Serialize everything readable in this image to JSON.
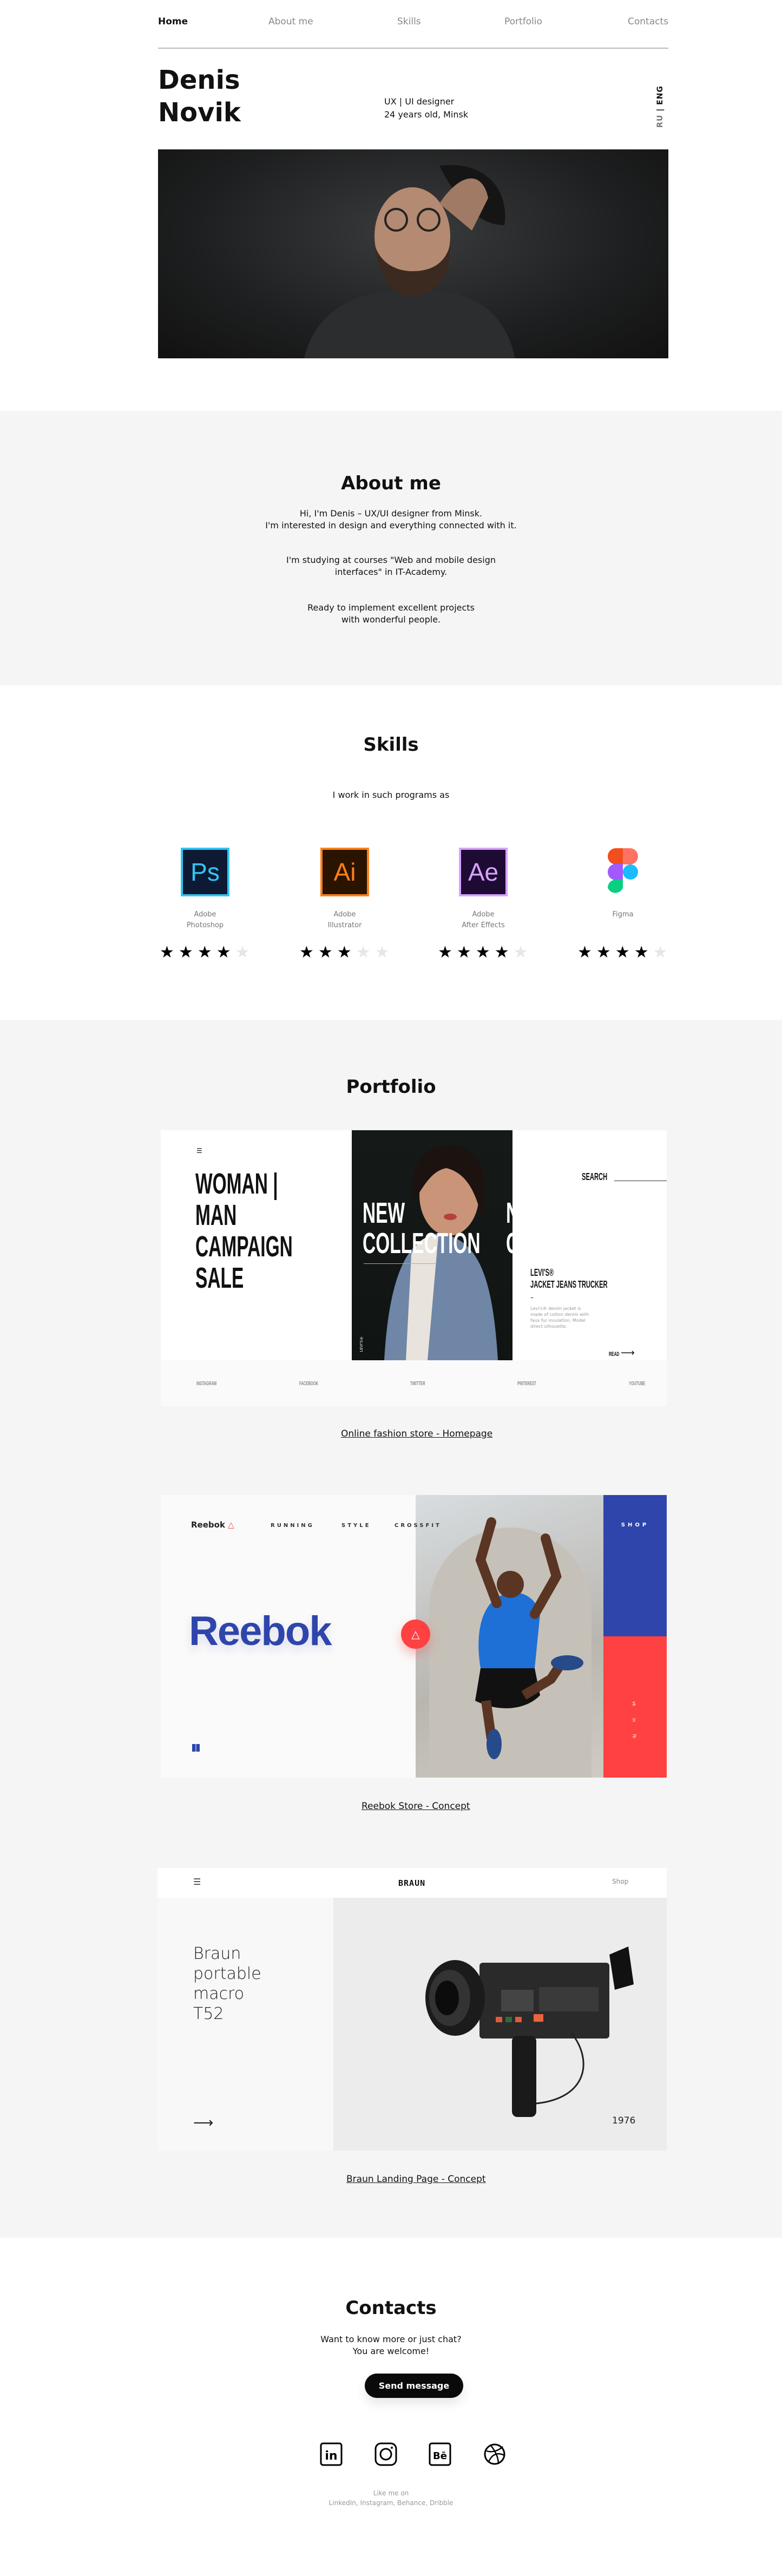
{
  "nav": {
    "items": [
      "Home",
      "About me",
      "Skills",
      "Portfolio",
      "Contacts"
    ],
    "active": "Home"
  },
  "header": {
    "first_name": "Denis",
    "last_name": "Novik",
    "role": "UX | UI designer",
    "age_city": "24 years old, Minsk",
    "lang_ru": "RU",
    "lang_sep": "|",
    "lang_eng": "ENG"
  },
  "about": {
    "title": "About me",
    "p1a": "Hi, I'm Denis – UX/UI designer from Minsk.",
    "p1b": "I'm interested in design and everything connected with it.",
    "p2a": "I'm studying at courses \"Web and mobile design",
    "p2b": "interfaces\" in IT-Academy.",
    "p3a": "Ready to implement excellent projects",
    "p3b": "with wonderful people."
  },
  "skills": {
    "title": "Skills",
    "subtitle": "I work in such programs as",
    "items": [
      {
        "abbr": "Ps",
        "l1": "Adobe",
        "l2": "Photoshop",
        "rating": 4,
        "color": "#31c5f4",
        "bg": "#0e1a33"
      },
      {
        "abbr": "Ai",
        "l1": "Adobe",
        "l2": "Illustrator",
        "rating": 3,
        "color": "#ff7f18",
        "bg": "#2a1400"
      },
      {
        "abbr": "Ae",
        "l1": "Adobe",
        "l2": "After Effects",
        "rating": 4,
        "color": "#d8a1ff",
        "bg": "#1d0b33"
      },
      {
        "abbr": "",
        "l1": "Figma",
        "l2": "",
        "rating": 4
      }
    ],
    "max_rating": 5
  },
  "portfolio": {
    "title": "Portfolio",
    "fashion": {
      "headline": [
        "WOMAN |",
        "MAN",
        "CAMPAIGN",
        "SALE"
      ],
      "new": "NEW",
      "collection": "COLLECTION",
      "search": "SEARCH",
      "brand": "LEVI'S®",
      "product": "JACKET JEANS TRUCKER",
      "dash": "–",
      "desc": "Levi's® denim jacket is made of cotton denim with faux fur insulation. Model direct silhouette.",
      "read": "READ",
      "vertical": "LEVI'S®",
      "socials": [
        "INSTAGRAM",
        "FACEBOOK",
        "TWITTER",
        "PINTEREST",
        "YOUTUBE"
      ],
      "caption": "Online fashion store - Homepage"
    },
    "reebok": {
      "logo": "Reebok",
      "nav": [
        "RUNNING",
        "STYLE",
        "CROSSFIT"
      ],
      "shop": "SHOP",
      "big": "Reebok",
      "socials": [
        "vk",
        "in",
        "fb"
      ],
      "caption": "Reebok Store - Concept",
      "blue": "#2f45ab",
      "red": "#ff4141"
    },
    "braun": {
      "logo": "BRAUN",
      "shop": "Shop",
      "title": [
        "Braun",
        "portable",
        "macro",
        "T52"
      ],
      "year": "1976",
      "caption": "Braun Landing Page - Concept"
    }
  },
  "contacts": {
    "title": "Contacts",
    "l1": "Want to know more or just chat?",
    "l2": "You are welcome!",
    "button": "Send message",
    "like1": "Like me on",
    "like2": "LinkedIn, Instagram, Behance, Dribble",
    "socials": [
      "linkedin",
      "instagram",
      "behance",
      "dribbble"
    ]
  }
}
